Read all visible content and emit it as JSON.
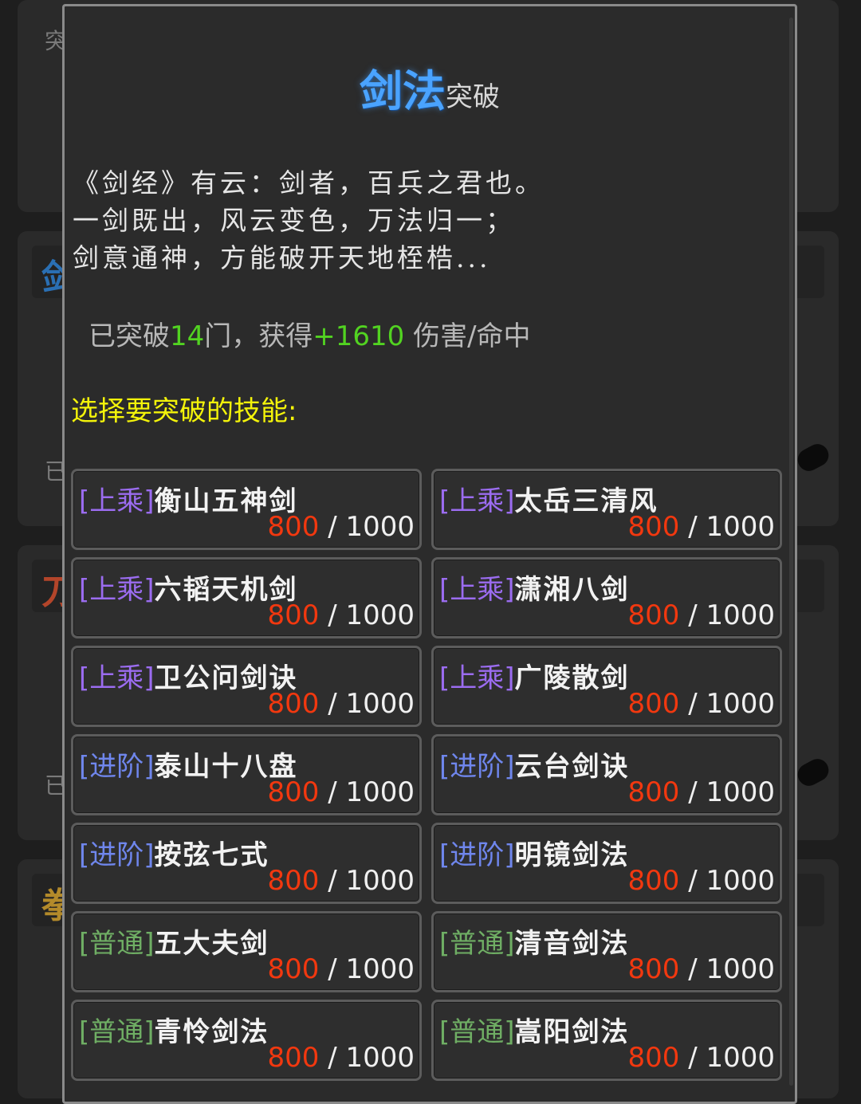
{
  "background": {
    "label_top": "突",
    "label_mid1": "已",
    "label_mid2": "已",
    "mark_1": "剑",
    "mark_2": "刀",
    "mark_3": "拳"
  },
  "modal": {
    "title_main": "剑法",
    "title_sub": "突破",
    "verse": [
      "《剑经》有云：剑者，百兵之君也。",
      "一剑既出，风云变色，万法归一；",
      "剑意通神，方能破开天地桎梏..."
    ],
    "summary": {
      "prefix": "已突破",
      "count": "14",
      "mid": "门，获得",
      "bonus": "+1610",
      "suffix": " 伤害/命中"
    },
    "prompt": "选择要突破的技能:"
  },
  "skills": [
    {
      "tier": "[上乘]",
      "name": "衡山五神剑",
      "current": "800",
      "max": "1000"
    },
    {
      "tier": "[上乘]",
      "name": "太岳三清风",
      "current": "800",
      "max": "1000"
    },
    {
      "tier": "[上乘]",
      "name": "六韬天机剑",
      "current": "800",
      "max": "1000"
    },
    {
      "tier": "[上乘]",
      "name": "潇湘八剑",
      "current": "800",
      "max": "1000"
    },
    {
      "tier": "[上乘]",
      "name": "卫公问剑诀",
      "current": "800",
      "max": "1000"
    },
    {
      "tier": "[上乘]",
      "name": "广陵散剑",
      "current": "800",
      "max": "1000"
    },
    {
      "tier": "[进阶]",
      "name": "泰山十八盘",
      "current": "800",
      "max": "1000"
    },
    {
      "tier": "[进阶]",
      "name": "云台剑诀",
      "current": "800",
      "max": "1000"
    },
    {
      "tier": "[进阶]",
      "name": "按弦七式",
      "current": "800",
      "max": "1000"
    },
    {
      "tier": "[进阶]",
      "name": "明镜剑法",
      "current": "800",
      "max": "1000"
    },
    {
      "tier": "[普通]",
      "name": "五大夫剑",
      "current": "800",
      "max": "1000"
    },
    {
      "tier": "[普通]",
      "name": "清音剑法",
      "current": "800",
      "max": "1000"
    },
    {
      "tier": "[普通]",
      "name": "青怜剑法",
      "current": "800",
      "max": "1000"
    },
    {
      "tier": "[普通]",
      "name": "嵩阳剑法",
      "current": "800",
      "max": "1000"
    }
  ],
  "progress_separator": " / ",
  "colors": {
    "title": "#4aa3ff",
    "prompt": "#f3f30a",
    "bonus": "#52d321",
    "current_value": "#f2380f",
    "tier_shangcheng": "#9b6cf0",
    "tier_jinjie": "#6f86ec",
    "tier_putong": "#6fae64"
  }
}
